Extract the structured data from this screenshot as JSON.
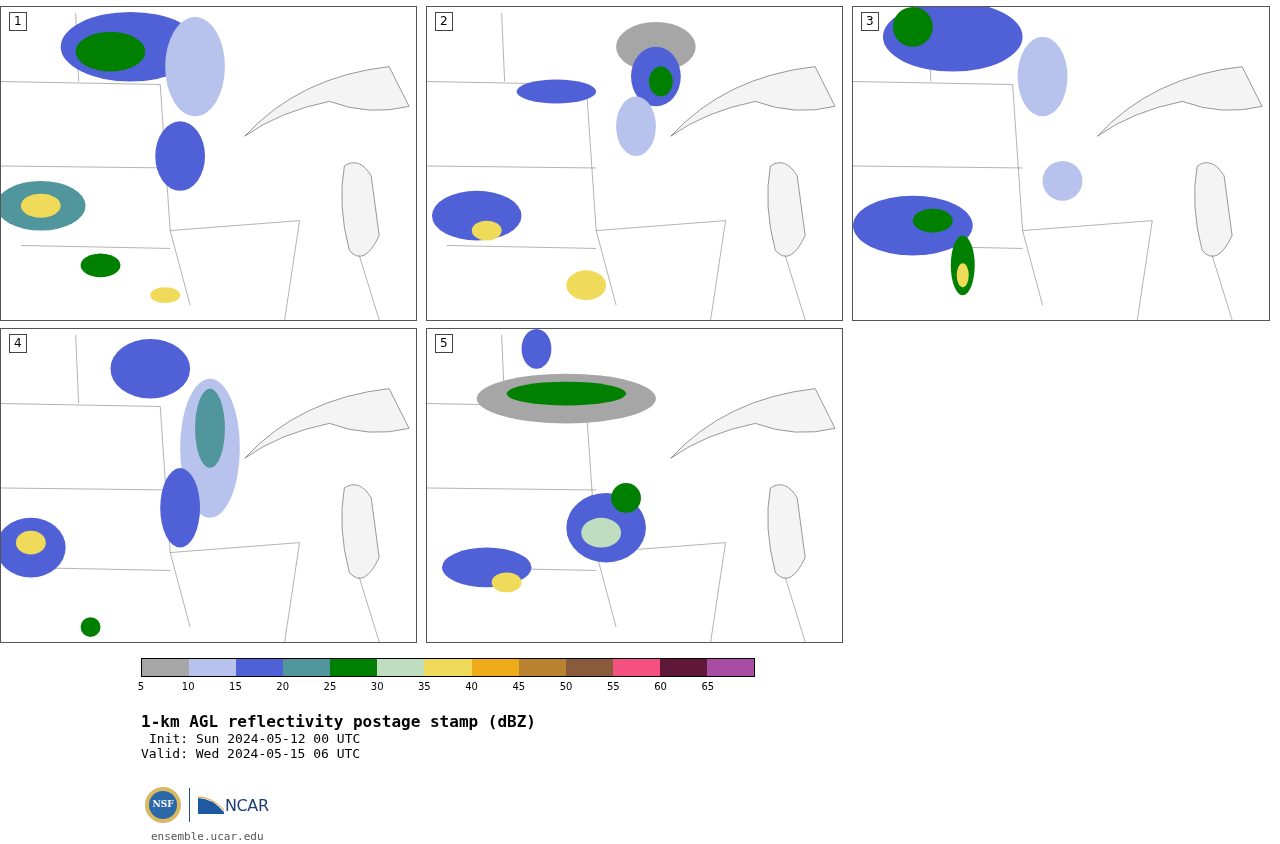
{
  "panels": [
    {
      "label": "1"
    },
    {
      "label": "2"
    },
    {
      "label": "3"
    },
    {
      "label": "4"
    },
    {
      "label": "5"
    }
  ],
  "colorbar": {
    "segments": [
      {
        "color": "#a6a6a6",
        "tick": "5"
      },
      {
        "color": "#b7c3ec",
        "tick": "10"
      },
      {
        "color": "#5060d6",
        "tick": "15"
      },
      {
        "color": "#50969c",
        "tick": "20"
      },
      {
        "color": "#008000",
        "tick": "25"
      },
      {
        "color": "#bfdebf",
        "tick": "30"
      },
      {
        "color": "#f0da5a",
        "tick": "35"
      },
      {
        "color": "#eeac18",
        "tick": "40"
      },
      {
        "color": "#b98230",
        "tick": "45"
      },
      {
        "color": "#8a5a3c",
        "tick": "50"
      },
      {
        "color": "#f45080",
        "tick": "55"
      },
      {
        "color": "#601838",
        "tick": "60"
      },
      {
        "color": "#a84ca4",
        "tick": "65"
      }
    ]
  },
  "title": "1-km AGL reflectivity postage stamp (dBZ)",
  "init": "Init: Sun 2024-05-12 00 UTC",
  "valid": "Valid: Wed 2024-05-15 06 UTC",
  "logos": {
    "nsf": "NSF",
    "ncar": "NCAR"
  },
  "url": "ensemble.ucar.edu"
}
